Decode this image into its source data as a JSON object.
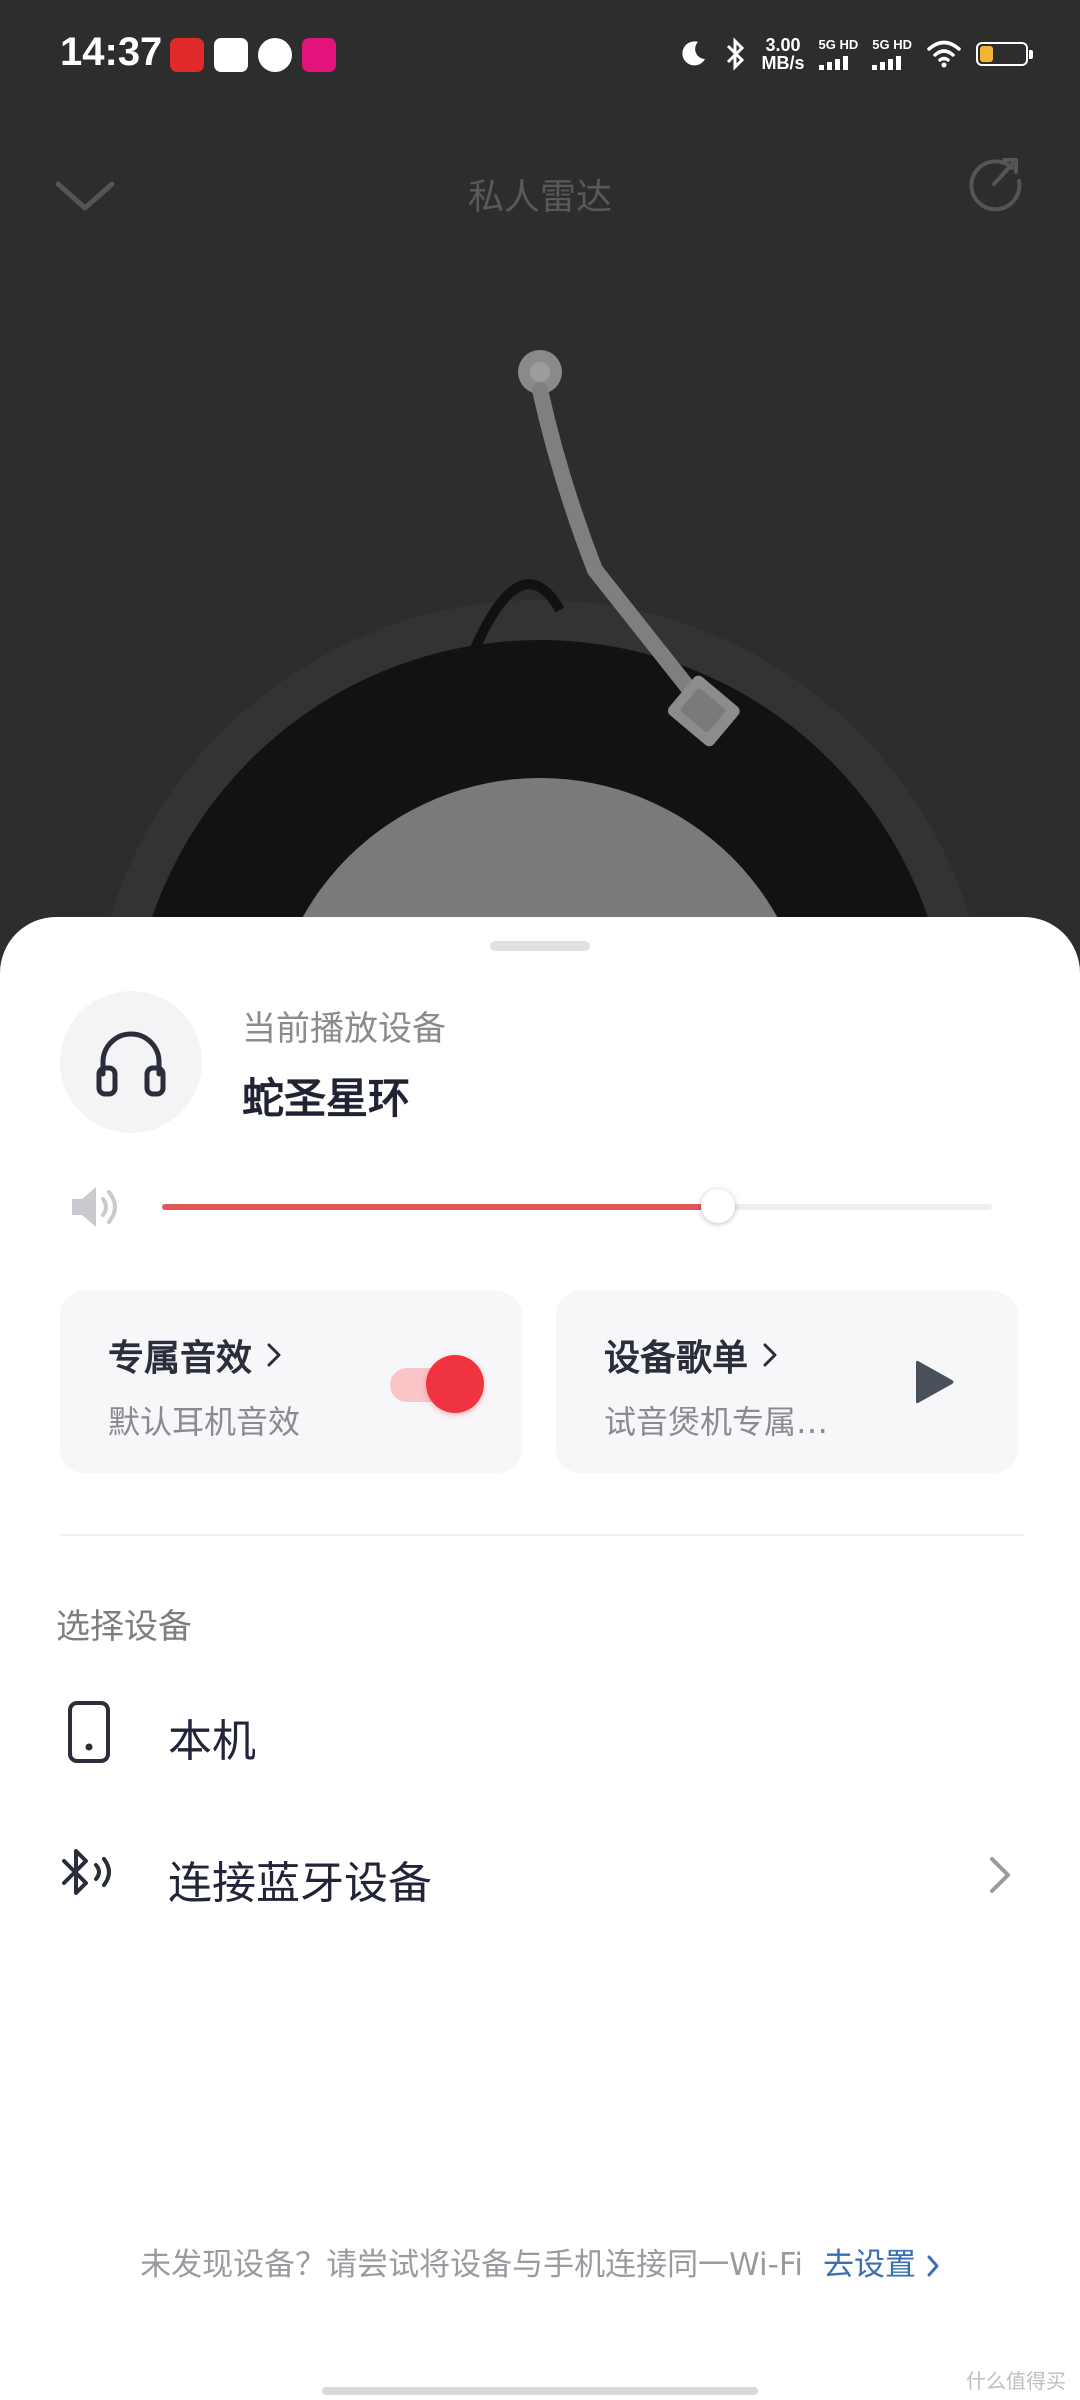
{
  "status_bar": {
    "time": "14:37",
    "net_speed_value": "3.00",
    "net_speed_unit": "MB/s",
    "sim1": "5G HD",
    "sim2": "5G HD",
    "battery_level": 0.35,
    "battery_color": "#f2b632"
  },
  "header": {
    "title": "私人雷达"
  },
  "device_sheet": {
    "current_label": "当前播放设备",
    "current_name": "蛇圣星环",
    "volume_level": 0.67,
    "sound_effect": {
      "title": "专属音效",
      "subtitle": "默认耳机音效",
      "enabled": true
    },
    "device_playlist": {
      "title": "设备歌单",
      "subtitle": "试音煲机专属…"
    },
    "select_label": "选择设备",
    "devices": [
      {
        "label": "本机",
        "icon": "phone-icon"
      },
      {
        "label": "连接蓝牙设备",
        "icon": "bluetooth-icon"
      }
    ],
    "footer_hint": "未发现设备？请尝试将设备与手机连接同一Wi-Fi",
    "footer_link": "去设置",
    "watermark": "什么值得买"
  },
  "colors": {
    "accent": "#ef3340",
    "volume_fill": "#e0575b",
    "link": "#3a6fb2"
  }
}
